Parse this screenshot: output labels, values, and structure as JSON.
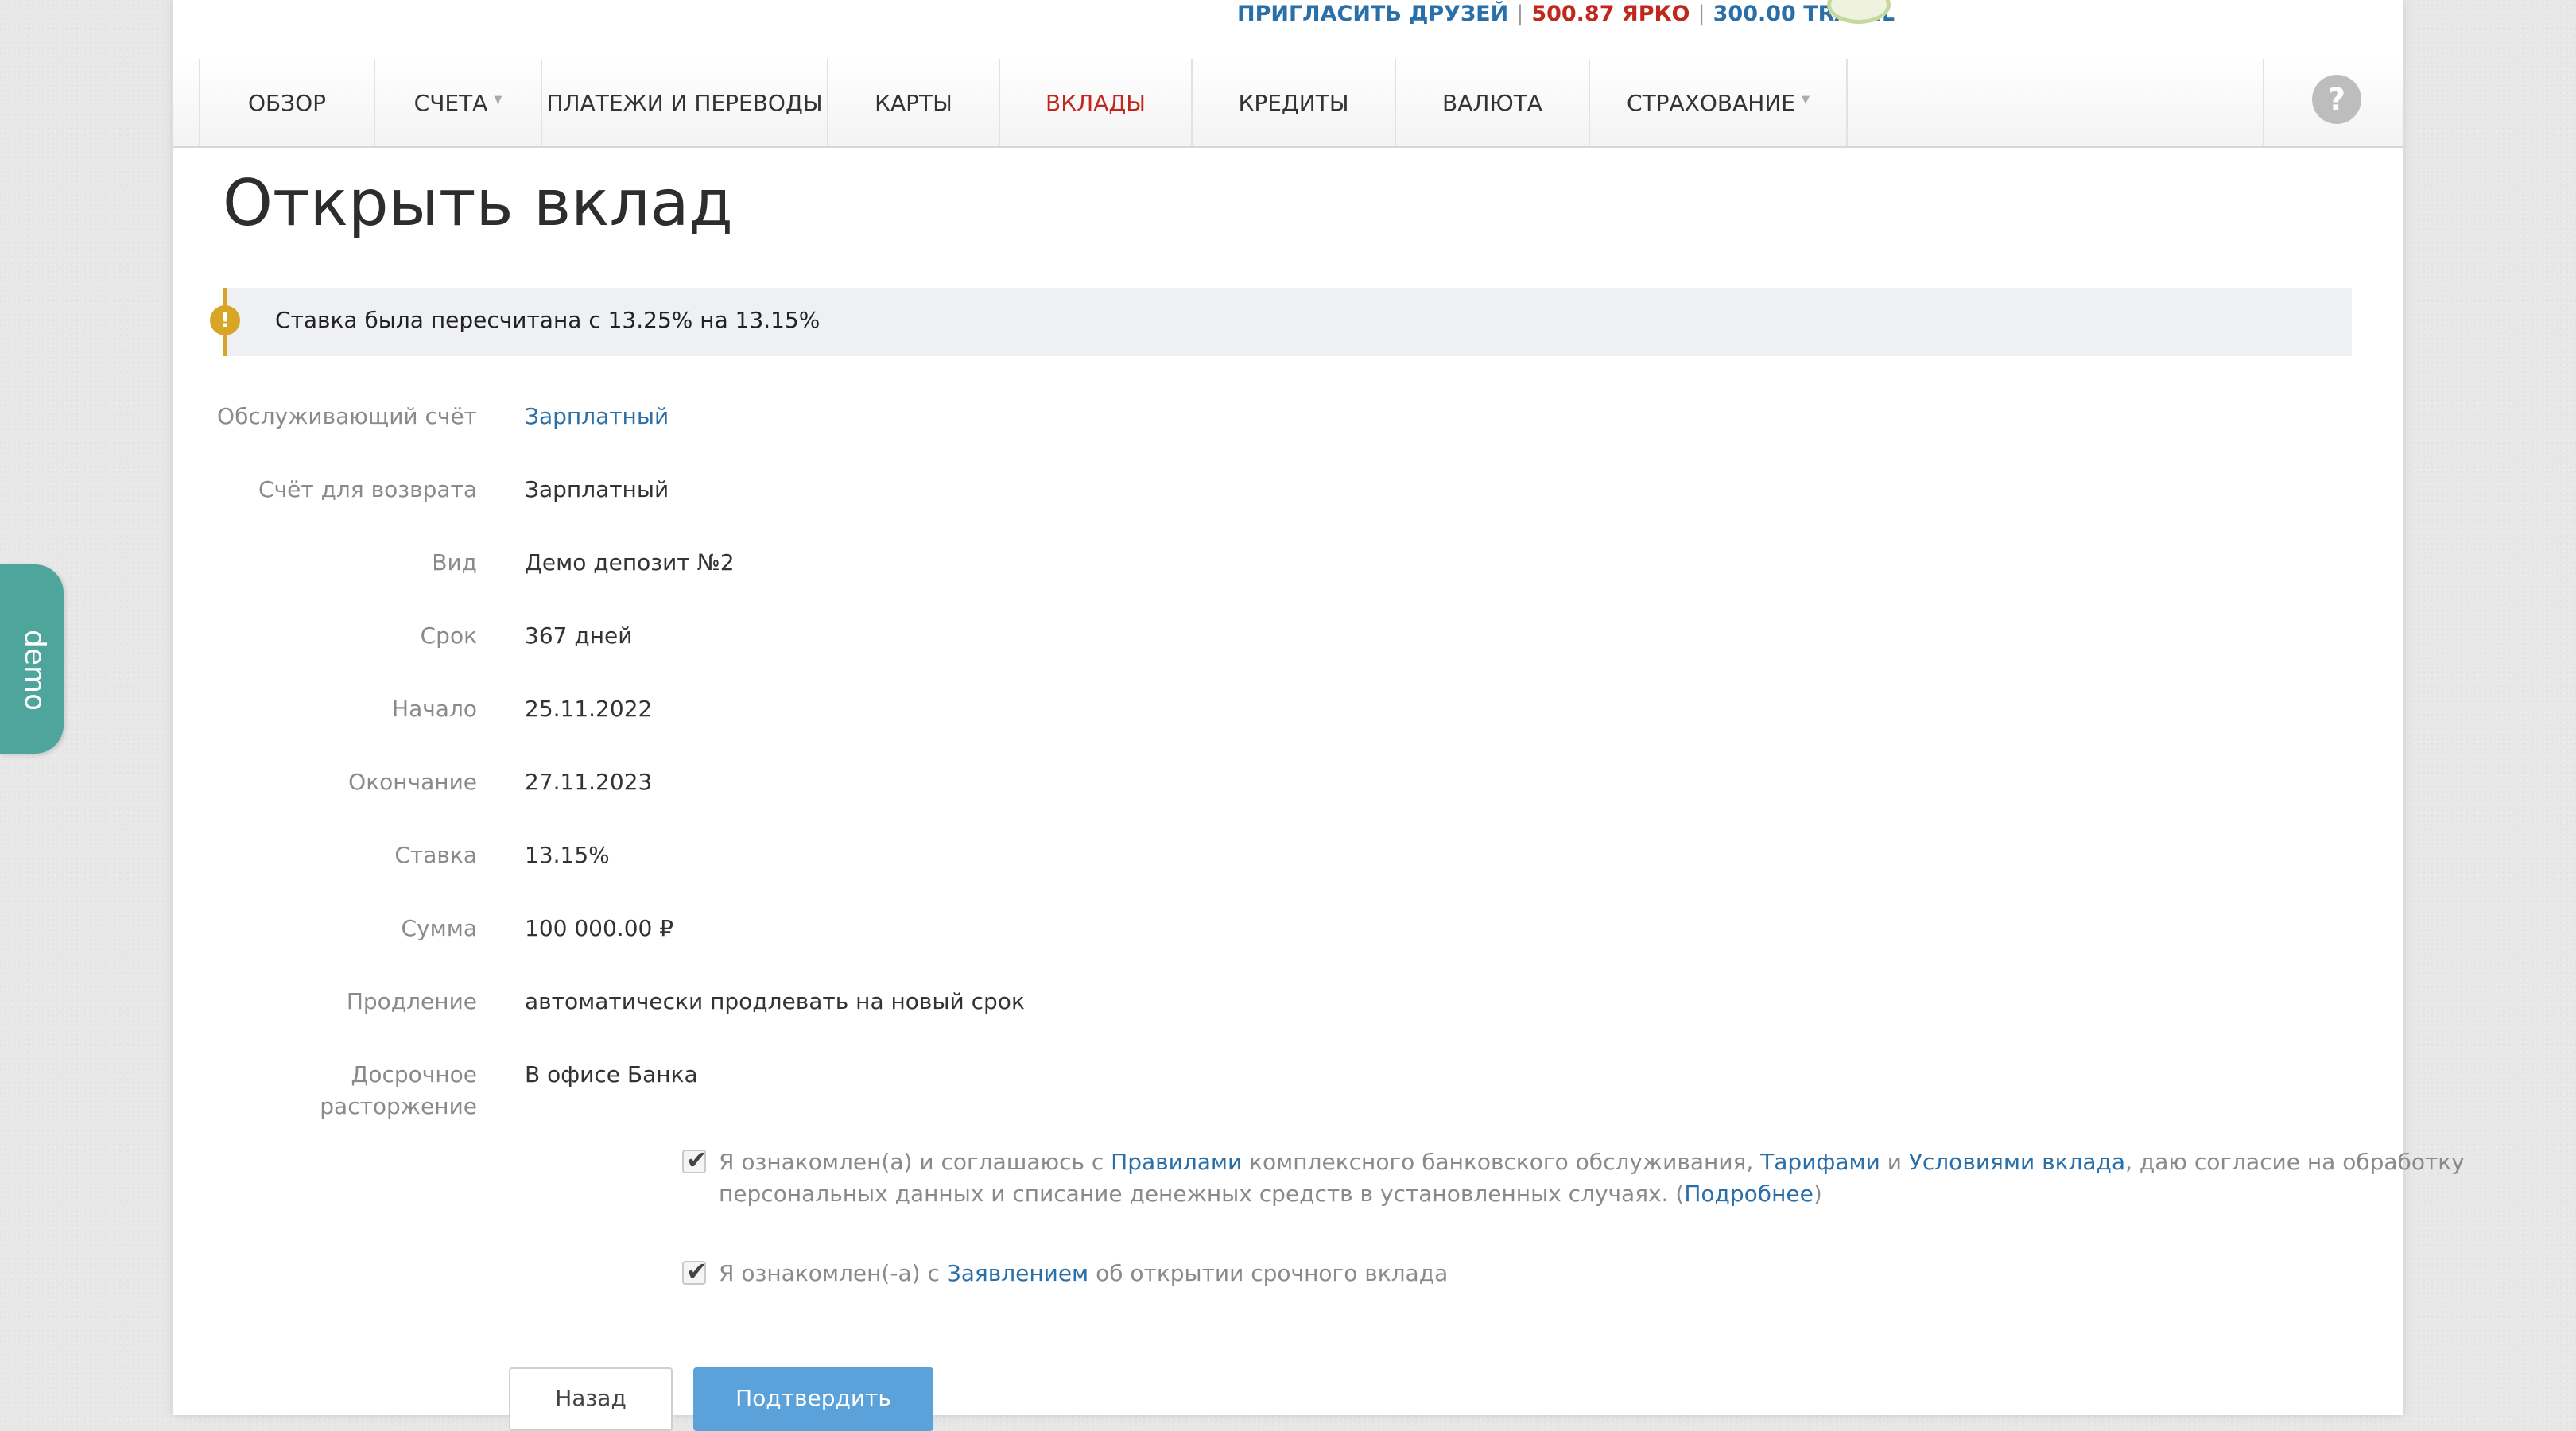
{
  "promo": {
    "invite": "ПРИГЛАСИТЬ ДРУЗЕЙ",
    "sep": "|",
    "yarko": "500.87 ЯРКО",
    "travel": "300.00 TRAVEL"
  },
  "nav": {
    "items": [
      {
        "label": "ОБЗОР"
      },
      {
        "label": "СЧЕТА"
      },
      {
        "label": "ПЛАТЕЖИ И ПЕРЕВОДЫ"
      },
      {
        "label": "КАРТЫ"
      },
      {
        "label": "ВКЛАДЫ"
      },
      {
        "label": "КРЕДИТЫ"
      },
      {
        "label": "ВАЛЮТА"
      },
      {
        "label": "СТРАХОВАНИЕ"
      }
    ],
    "help": "?"
  },
  "page_title": "Открыть вклад",
  "alert": {
    "icon": "!",
    "text": "Ставка была пересчитана с 13.25% на 13.15%"
  },
  "fields": [
    {
      "label": "Обслуживающий счёт",
      "value": "Зарплатный"
    },
    {
      "label": "Счёт для возврата",
      "value": "Зарплатный"
    },
    {
      "label": "Вид",
      "value": "Демо депозит №2"
    },
    {
      "label": "Срок",
      "value": "367 дней"
    },
    {
      "label": "Начало",
      "value": "25.11.2022"
    },
    {
      "label": "Окончание",
      "value": "27.11.2023"
    },
    {
      "label": "Ставка",
      "value": "13.15%"
    },
    {
      "label": "Сумма",
      "value": "100 000.00 ₽"
    },
    {
      "label": "Продление",
      "value": "автоматически продлевать на новый срок"
    },
    {
      "label_line1": "Досрочное",
      "label_line2": "расторжение",
      "value": "В офисе Банка"
    }
  ],
  "agreements": {
    "first": {
      "part1": "Я ознакомлен(а) и соглашаюсь с ",
      "link_rules": "Правилами",
      "part2": " комплексного банковского обслуживания, ",
      "link_tariffs": "Тарифами",
      "part3": " и ",
      "link_conditions": "Условиями вклада",
      "part4": ", даю согласие на обработку персональных данных и списание денежных средств в установленных случаях. (",
      "link_more": "Подробнее",
      "part5": ")"
    },
    "second": {
      "part1": "Я ознакомлен(-а) с ",
      "link_statement": "Заявлением",
      "part2": " об открытии срочного вклада"
    }
  },
  "buttons": {
    "back": "Назад",
    "confirm": "Подтвердить"
  },
  "demo_tab": "demo",
  "colors": {
    "accent_red": "#c0281d",
    "link_blue": "#2a6fa8",
    "confirm_blue": "#5ba2da",
    "alert_yellow": "#d9a527",
    "demo_teal": "#4ea59c"
  }
}
